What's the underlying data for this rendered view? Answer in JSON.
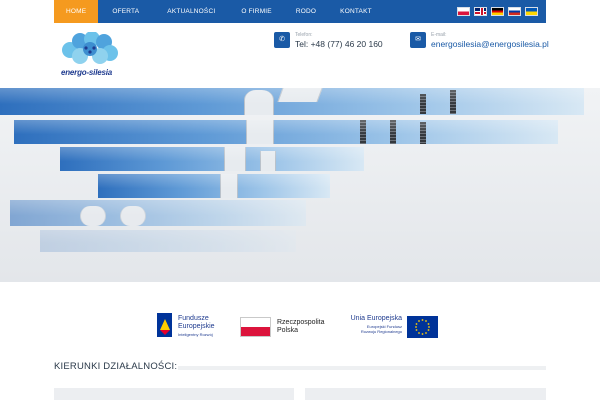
{
  "nav": {
    "items": [
      {
        "label": "HOME"
      },
      {
        "label": "OFERTA"
      },
      {
        "label": "AKTUALNOŚCI"
      },
      {
        "label": "O FIRMIE"
      },
      {
        "label": "RODO"
      },
      {
        "label": "KONTAKT"
      }
    ],
    "active_color": "#f59a1f",
    "bar_color": "#1a5aa6",
    "languages": [
      "pl",
      "en",
      "de",
      "ru",
      "ua"
    ]
  },
  "header": {
    "logo_text": "energo-silesia",
    "phone": {
      "label": "Telefon:",
      "value": "Tel: +48 (77) 46 20 160",
      "icon": "phone-icon"
    },
    "email": {
      "label": "E-mail:",
      "value": "energosilesia@energosilesia.pl",
      "icon": "envelope-icon"
    }
  },
  "partners": {
    "fe": {
      "title_line1": "Fundusze",
      "title_line2": "Europejskie",
      "sub": "Inteligentny Rozwój"
    },
    "rp": {
      "line1": "Rzeczpospolita",
      "line2": "Polska"
    },
    "ue": {
      "title": "Unia Europejska",
      "sub_line1": "Europejski Fundusz",
      "sub_line2": "Rozwoju Regionalnego"
    }
  },
  "section": {
    "title": "KIERUNKI DZIAŁALNOŚCI:"
  }
}
